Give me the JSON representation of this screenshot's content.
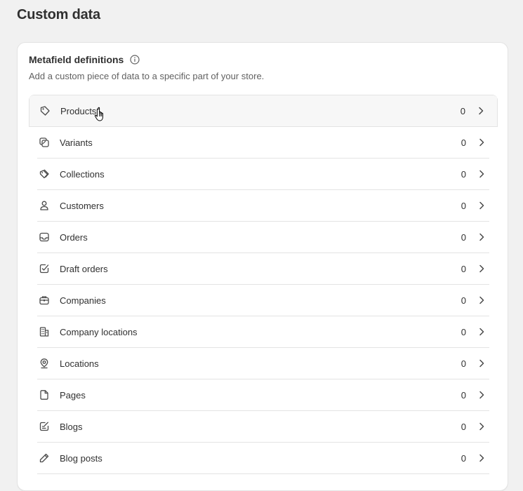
{
  "page": {
    "title": "Custom data"
  },
  "card": {
    "title": "Metafield definitions",
    "description": "Add a custom piece of data to a specific part of your store."
  },
  "items": [
    {
      "label": "Products",
      "count": "0",
      "icon": "tag-icon"
    },
    {
      "label": "Variants",
      "count": "0",
      "icon": "variants-icon"
    },
    {
      "label": "Collections",
      "count": "0",
      "icon": "collection-icon"
    },
    {
      "label": "Customers",
      "count": "0",
      "icon": "person-icon"
    },
    {
      "label": "Orders",
      "count": "0",
      "icon": "inbox-icon"
    },
    {
      "label": "Draft orders",
      "count": "0",
      "icon": "draft-order-icon"
    },
    {
      "label": "Companies",
      "count": "0",
      "icon": "briefcase-icon"
    },
    {
      "label": "Company locations",
      "count": "0",
      "icon": "building-icon"
    },
    {
      "label": "Locations",
      "count": "0",
      "icon": "location-pin-icon"
    },
    {
      "label": "Pages",
      "count": "0",
      "icon": "page-icon"
    },
    {
      "label": "Blogs",
      "count": "0",
      "icon": "blog-icon"
    },
    {
      "label": "Blog posts",
      "count": "0",
      "icon": "pencil-icon"
    }
  ]
}
